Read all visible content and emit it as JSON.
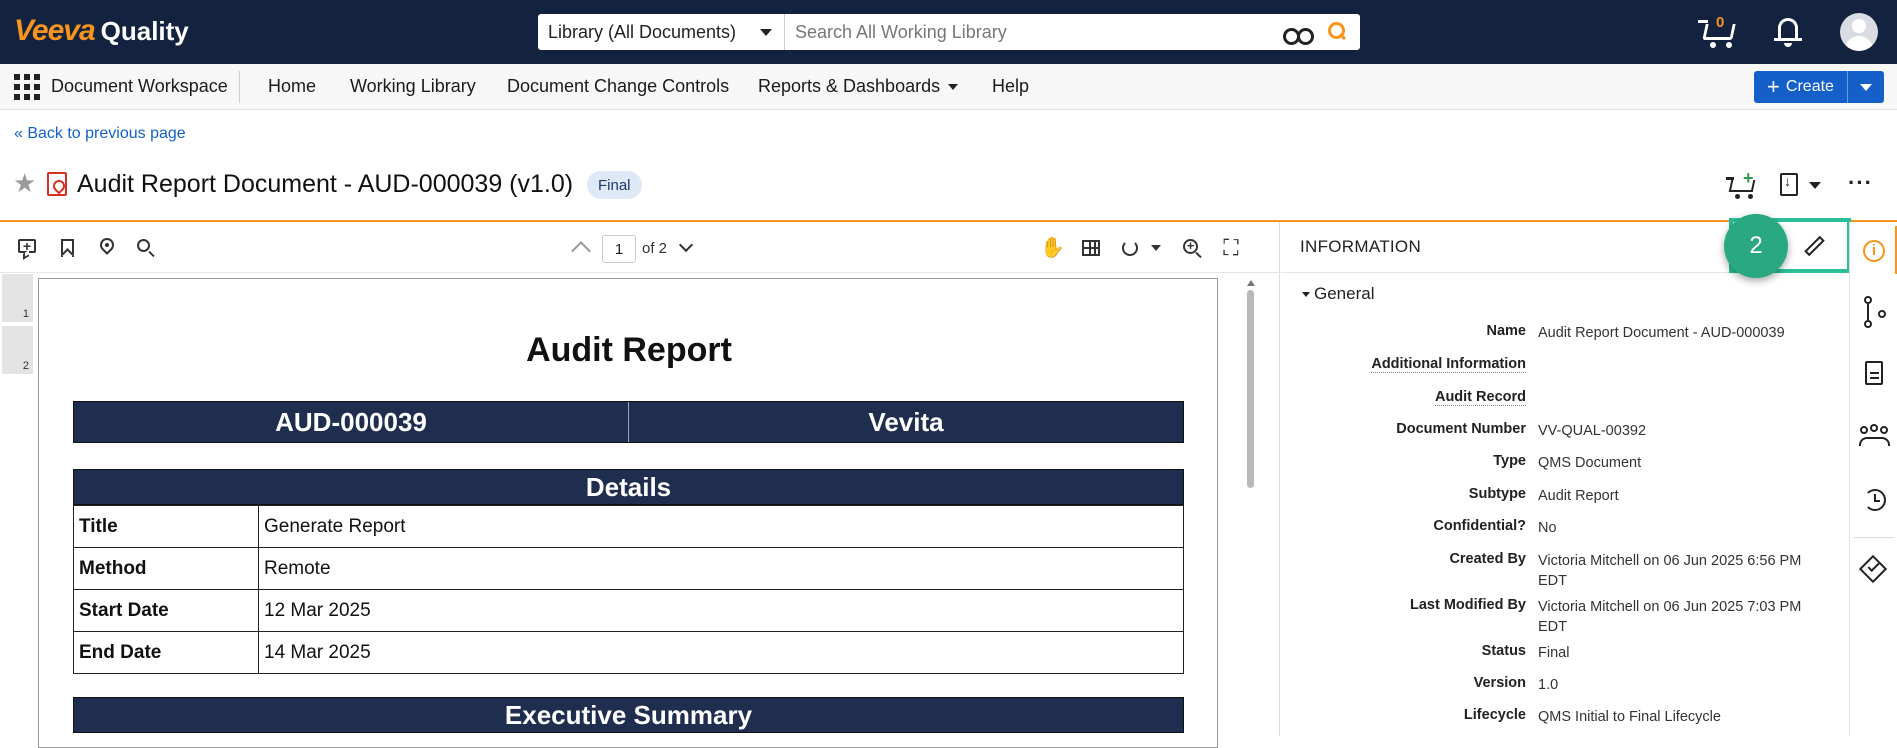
{
  "brand": {
    "logo_text": "Veeva",
    "product": "Quality",
    "accent": "#f7941d",
    "navy": "#12223f"
  },
  "search": {
    "scope": "Library (All Documents)",
    "placeholder": "Search All Working Library"
  },
  "topbar": {
    "cart_count": "0",
    "icons": [
      "cart-icon",
      "bell-icon",
      "avatar"
    ]
  },
  "nav": {
    "workspace": "Document Workspace",
    "items": [
      {
        "label": "Home"
      },
      {
        "label": "Working Library"
      },
      {
        "label": "Document Change Controls"
      },
      {
        "label": "Reports & Dashboards"
      },
      {
        "label": "Help"
      }
    ],
    "create_label": "Create"
  },
  "header": {
    "back_link": "« Back to previous page",
    "title": "Audit Report Document - AUD-000039 (v1.0)",
    "status": "Final"
  },
  "viewer": {
    "page_current": "1",
    "page_of": "of 2",
    "thumbnails": [
      "1",
      "2"
    ]
  },
  "document": {
    "title": "Audit Report",
    "audit_id": "AUD-000039",
    "organization": "Vevita",
    "details_heading": "Details",
    "details": [
      {
        "key": "Title",
        "value": "Generate Report"
      },
      {
        "key": "Method",
        "value": "Remote"
      },
      {
        "key": "Start Date",
        "value": "12 Mar 2025"
      },
      {
        "key": "End Date",
        "value": "14 Mar 2025"
      }
    ],
    "exec_heading": "Executive Summary"
  },
  "info_panel": {
    "heading": "INFORMATION",
    "step_badge": "2",
    "section": "General",
    "fields": [
      {
        "label": "Name",
        "value": "Audit Report Document - AUD-000039"
      },
      {
        "label": "Additional Information",
        "value": ""
      },
      {
        "label": "Audit Record",
        "value": ""
      },
      {
        "label": "Document Number",
        "value": "VV-QUAL-00392"
      },
      {
        "label": "Type",
        "value": "QMS Document"
      },
      {
        "label": "Subtype",
        "value": "Audit Report"
      },
      {
        "label": "Confidential?",
        "value": "No"
      },
      {
        "label": "Created By",
        "value": "Victoria Mitchell on 06 Jun 2025 6:56 PM EDT"
      },
      {
        "label": "Last Modified By",
        "value": "Victoria Mitchell on 06 Jun 2025 7:03 PM EDT"
      },
      {
        "label": "Status",
        "value": "Final"
      },
      {
        "label": "Version",
        "value": "1.0"
      },
      {
        "label": "Lifecycle",
        "value": "QMS Initial to Final Lifecycle"
      }
    ]
  },
  "rail": {
    "icons": [
      "info-icon",
      "relationships-icon",
      "document-icon",
      "sharing-icon",
      "history-icon",
      "verify-icon"
    ]
  }
}
